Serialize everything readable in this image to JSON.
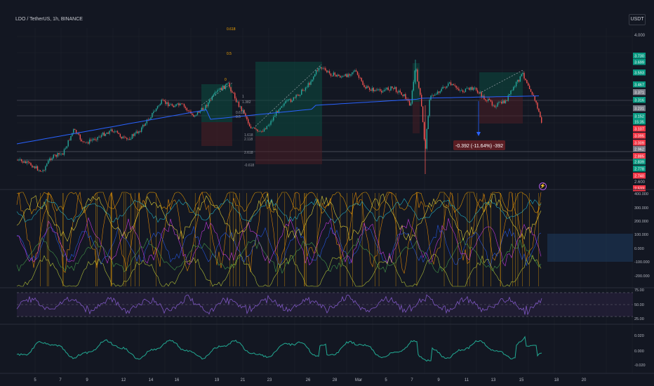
{
  "header": {
    "title": "LDO / TetherUS, 1h, BINANCE",
    "currency": "USDT"
  },
  "price_axis": {
    "ticks": [
      "4.000",
      "2.600"
    ]
  },
  "price_tags": [
    {
      "label": "3.730",
      "color": "#089981"
    },
    {
      "label": "3.699",
      "color": "#089981"
    },
    {
      "label": "3.593",
      "color": "#089981"
    },
    {
      "label": "3.467",
      "color": "#089981"
    },
    {
      "label": "3.371",
      "color": "#787b86"
    },
    {
      "label": "3.316",
      "color": "#089981"
    },
    {
      "label": "3.231",
      "color": "#787b86"
    },
    {
      "label": "3.152",
      "color": "#089981"
    },
    {
      "label": "15:35",
      "color": "#089981"
    },
    {
      "label": "3.107",
      "color": "#f23645"
    },
    {
      "label": "3.095",
      "color": "#f23645"
    },
    {
      "label": "3.009",
      "color": "#f23645"
    },
    {
      "label": "2.962",
      "color": "#787b86"
    },
    {
      "label": "2.885",
      "color": "#f23645"
    },
    {
      "label": "2.839",
      "color": "#089981"
    },
    {
      "label": "2.778",
      "color": "#089981"
    },
    {
      "label": "2.740",
      "color": "#f23645"
    },
    {
      "label": "2.533",
      "color": "#f23645"
    }
  ],
  "measure_label": "-0.392 (-11.64%) -392",
  "fib_labels": [
    "0.618",
    "0.5",
    "0",
    "1",
    "1.382",
    "1.618",
    "2.118",
    "2.618",
    "-0.618",
    "0.618",
    "0.5"
  ],
  "osc_axis": [
    "400.000",
    "300.000",
    "200.000",
    "100.000",
    "0.000",
    "-100.000",
    "-200.000"
  ],
  "rsi_axis": [
    "75.00",
    "50.00",
    "25.00"
  ],
  "bottom_axis": [
    "0.020",
    "0.000",
    "-0.020"
  ],
  "time_axis": [
    "5",
    "7",
    "9",
    "12",
    "14",
    "16",
    "19",
    "21",
    "23",
    "26",
    "28",
    "Mar",
    "5",
    "7",
    "9",
    "11",
    "13",
    "15",
    "18",
    "20"
  ],
  "colors": {
    "bg": "#131722",
    "up": "#26a69a",
    "down": "#ef5350",
    "ma": "#2962ff",
    "accent": "#f7a600",
    "rsi": "#7e57c2",
    "teal": "#22ab94"
  }
}
